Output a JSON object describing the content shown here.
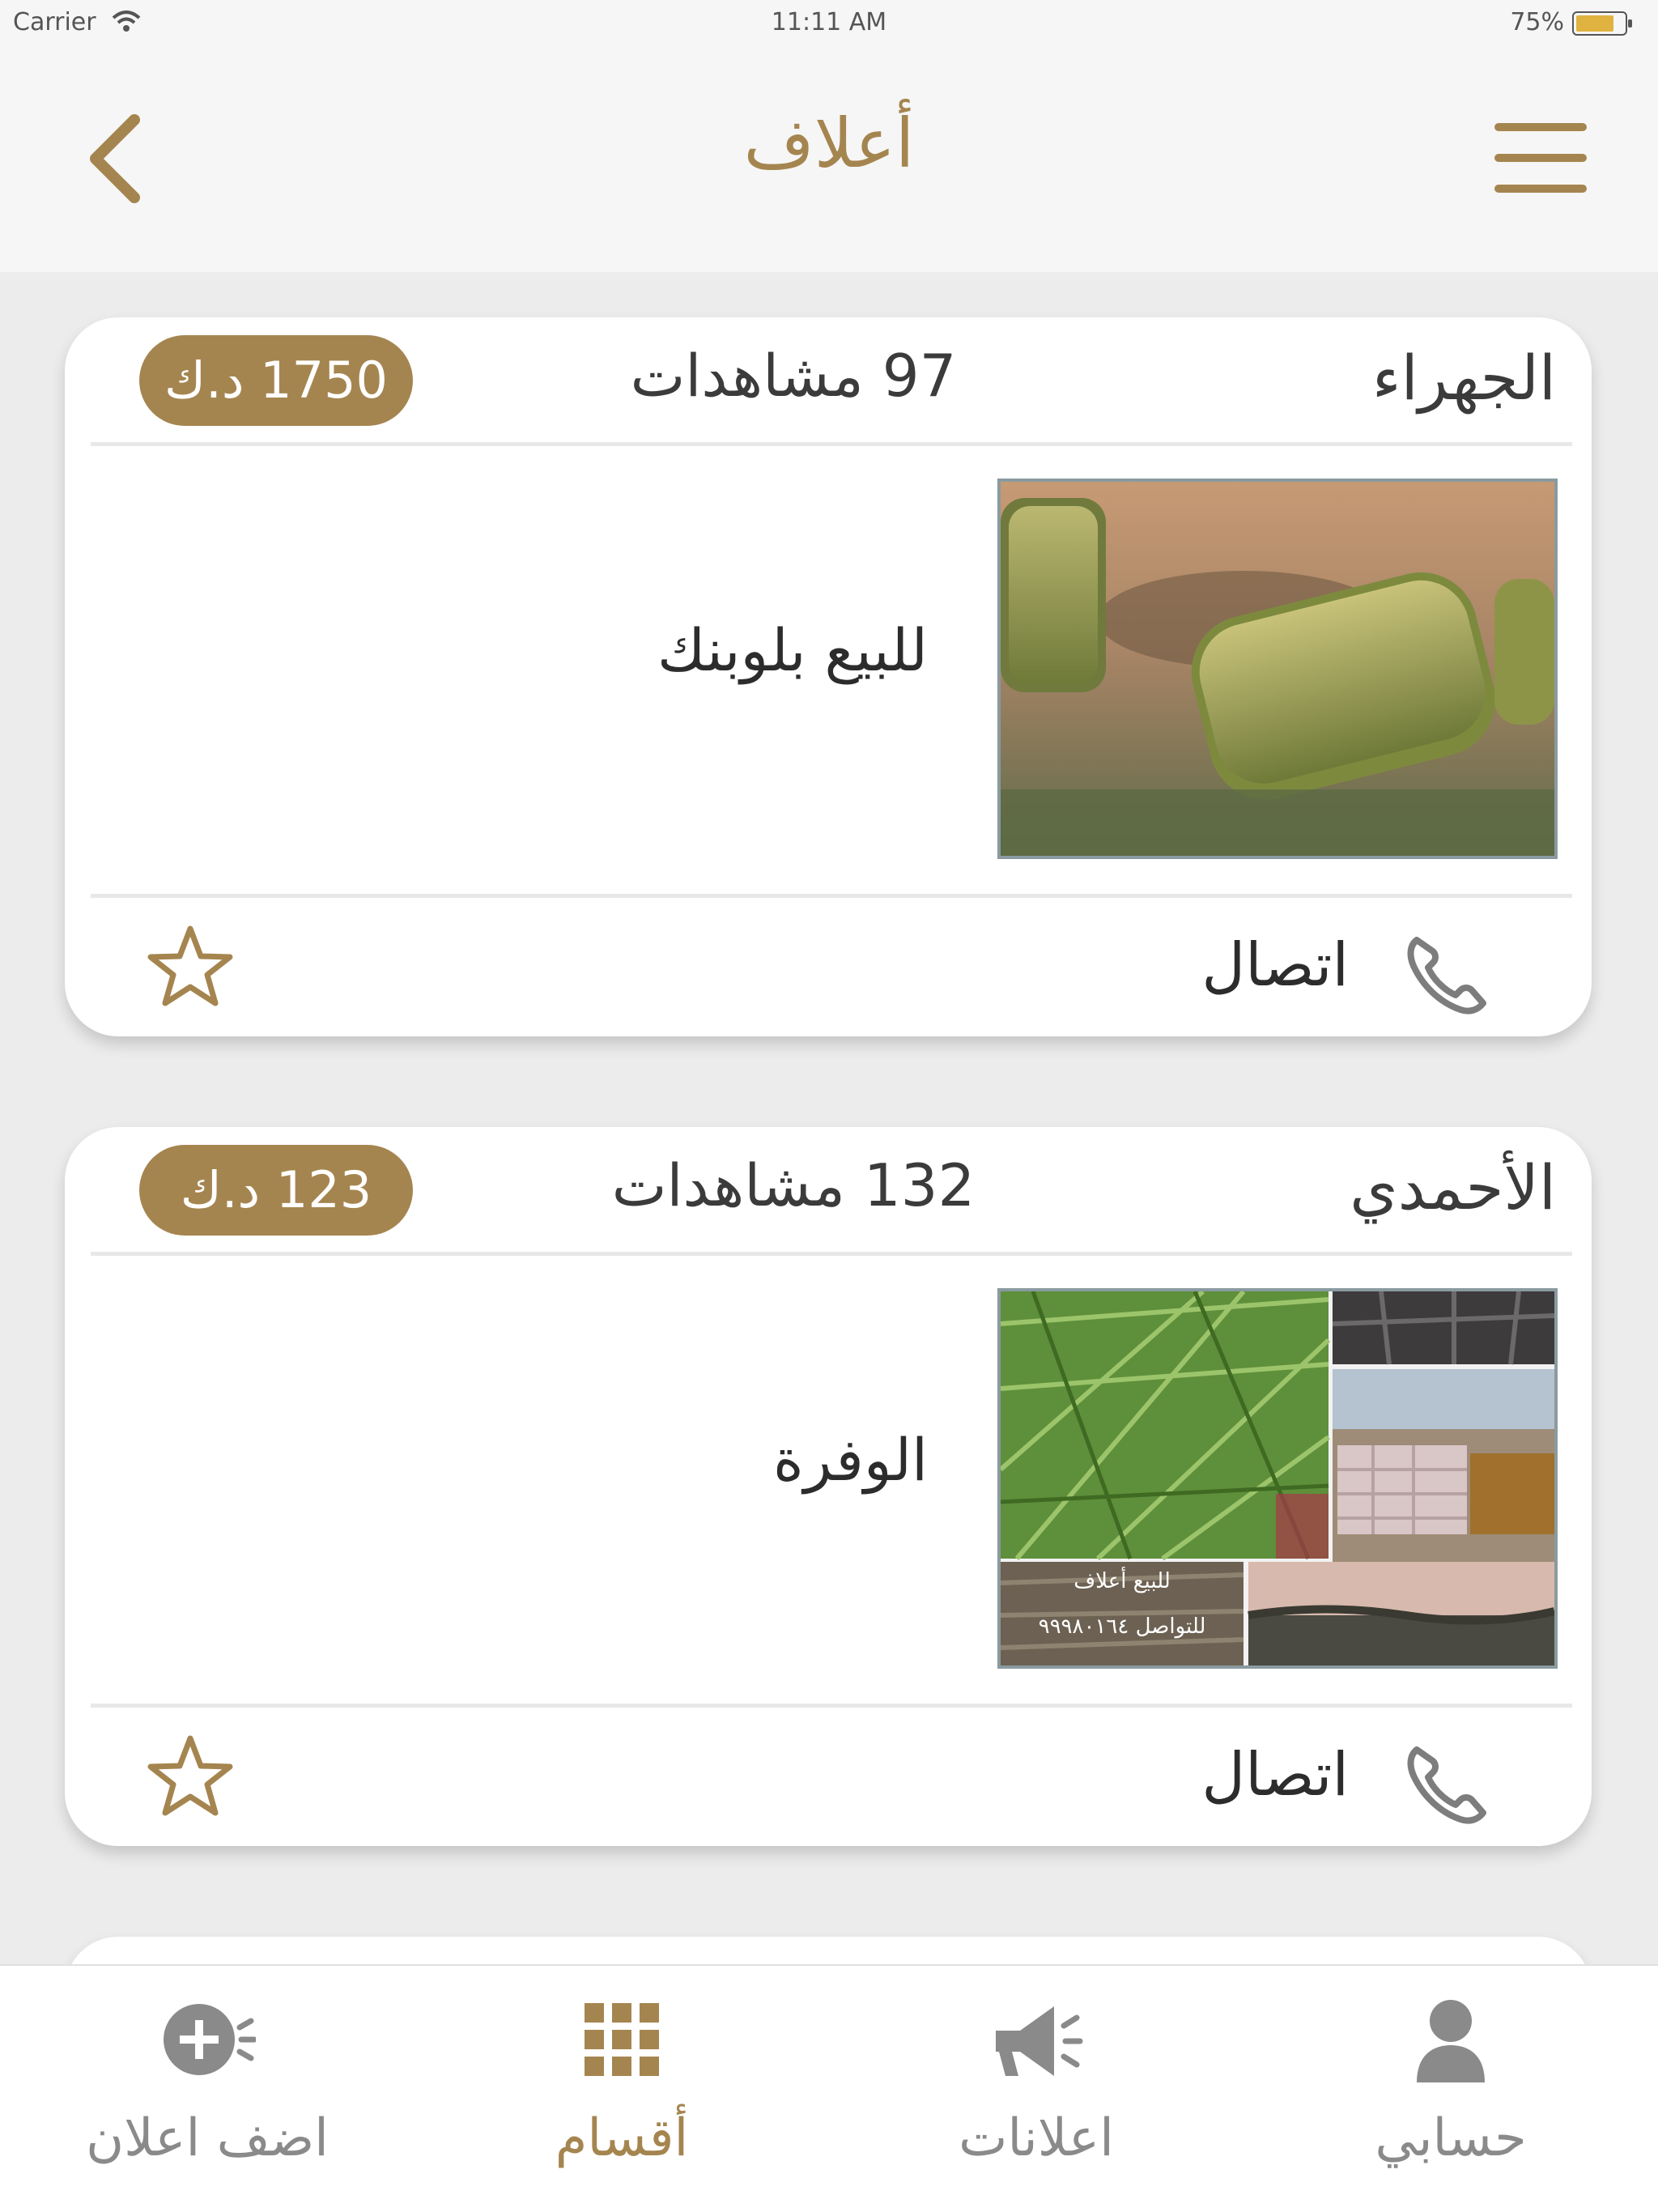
{
  "status_bar": {
    "carrier": "Carrier",
    "time": "11:11 AM",
    "battery": "75%"
  },
  "nav": {
    "title": "أعلاف",
    "accent_color": "#a5854f"
  },
  "listings": [
    {
      "location": "الجهراء",
      "views": "97 مشاهدات",
      "price": "1750 د.ك",
      "title": "للبيع بلوبنك",
      "call_label": "اتصال"
    },
    {
      "location": "الأحمدي",
      "views": "132 مشاهدات",
      "price": "123 د.ك",
      "title": "الوفرة",
      "call_label": "اتصال",
      "image_text_line1": "للبيع أعلاف",
      "image_text_line2": "للتواصل ٩٩٩٨٠١٦٤"
    }
  ],
  "tabs": [
    {
      "label": "اضف اعلان",
      "icon": "add-ad-icon"
    },
    {
      "label": "أقسام",
      "icon": "grid-icon",
      "active": true
    },
    {
      "label": "اعلانات",
      "icon": "megaphone-icon"
    },
    {
      "label": "حسابي",
      "icon": "user-icon"
    }
  ]
}
